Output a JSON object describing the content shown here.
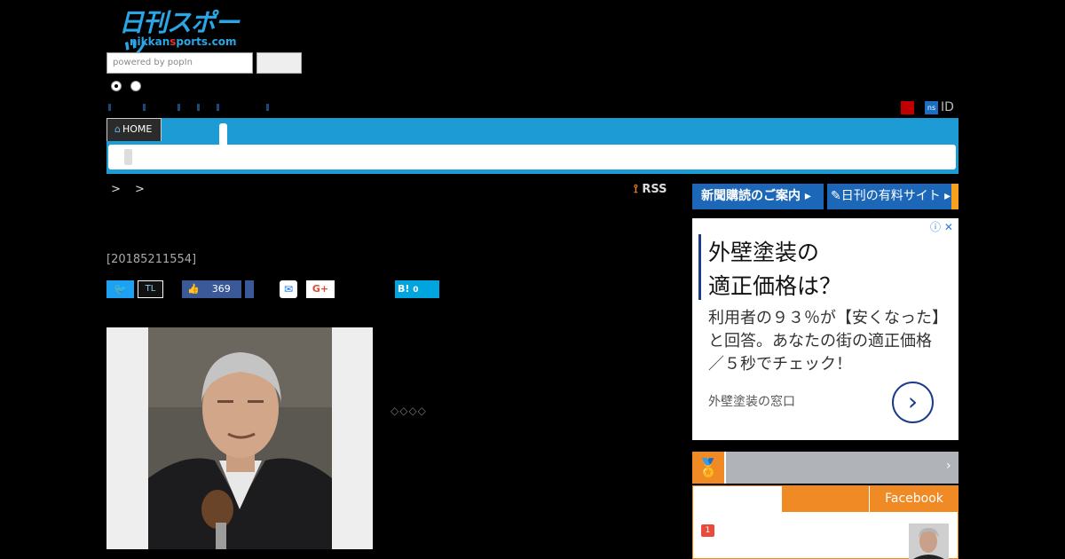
{
  "header": {
    "logo_text": "日刊スポーツ",
    "logo_sub_a": "nikkan",
    "logo_sub_b": "s",
    "logo_sub_c": "ports.com",
    "search_placeholder": "powered by popIn",
    "id_label": "ID",
    "ns_label": "ns"
  },
  "nav": {
    "home_label": "HOME",
    "home_icon": "home-icon"
  },
  "article": {
    "breadcrumb": "> >",
    "rss_label": "RSS",
    "timestamp": "[20185211554]",
    "diamonds": "◇◇◇◇"
  },
  "share": {
    "twitter_icon": "twitter-icon",
    "timeline_label": "TL",
    "facebook_count": "369",
    "google_plus_label": "G+",
    "hatena_label": "B!",
    "hatena_count": "0"
  },
  "sidebar": {
    "banner_subscribe": "新聞購読のご案内",
    "banner_paid": "日刊の有料サイト",
    "ad": {
      "headline_line1": "外壁塗装の",
      "headline_line2": "適正価格は？",
      "body": "利用者の９３％が【安くなった】と回答。あなたの街の適正価格／５秒でチェック！",
      "source": "外壁塗装の窓口"
    },
    "ranking": {
      "tab_facebook": "Facebook",
      "first_rank": "1"
    }
  },
  "colors": {
    "nav_blue": "#1c9bd4",
    "ranking_orange": "#f08a24",
    "banner_blue": "#1d67b8"
  }
}
